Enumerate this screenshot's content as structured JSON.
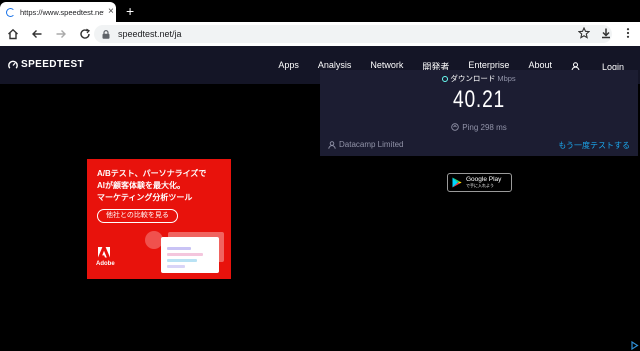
{
  "browser": {
    "tab_title": "https://www.speedtest.net/ja",
    "tab_close": "×",
    "new_tab": "+",
    "url": "speedtest.net/ja"
  },
  "site": {
    "logo": "SPEEDTEST",
    "nav": [
      "Apps",
      "Analysis",
      "Network",
      "開発者",
      "Enterprise",
      "About",
      "Login"
    ]
  },
  "result": {
    "download_label": "ダウンロード",
    "unit": "Mbps",
    "speed": "40.21",
    "ping": "Ping 298 ms",
    "isp": "Datacamp Limited",
    "retry": "もう一度テストする"
  },
  "ad": {
    "line1": "A/Bテスト、パーソナライズで",
    "line2": "AIが顧客体験を最大化。",
    "line3": "マーケティング分析ツール",
    "cta": "他社との比較を見る",
    "brand": "Adobe",
    "color": "#e8120c"
  },
  "gplay": {
    "line1": "Google Play",
    "line2": "で手に入れよう"
  },
  "colors": {
    "header_bg": "#141526",
    "panel_bg": "#1c1d32",
    "accent": "#1ba8ee",
    "muted": "#9193a8"
  }
}
